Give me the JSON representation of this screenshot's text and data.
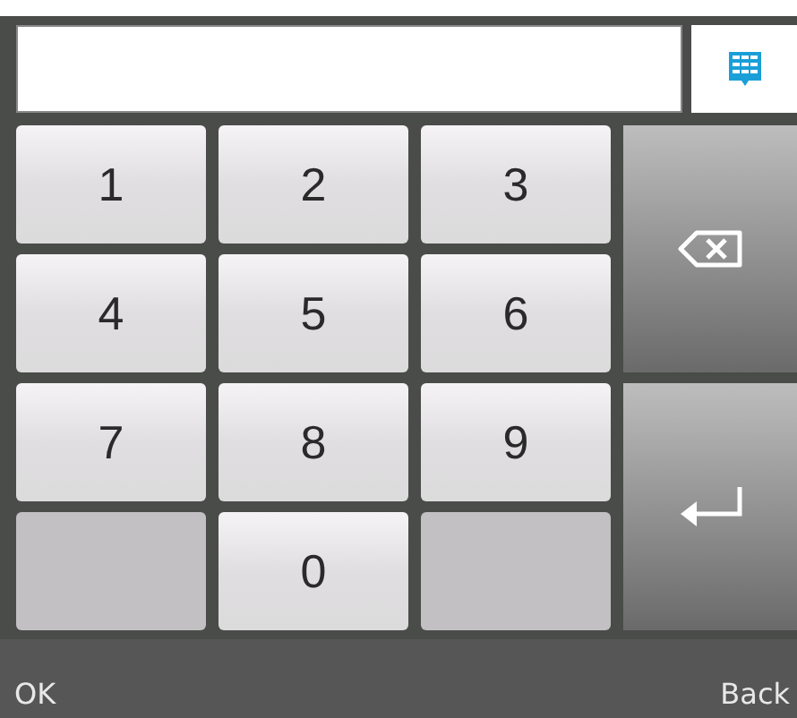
{
  "keys": [
    {
      "kind": "digit",
      "label": "1"
    },
    {
      "kind": "digit",
      "label": "2"
    },
    {
      "kind": "digit",
      "label": "3"
    },
    {
      "kind": "backspace"
    },
    {
      "kind": "digit",
      "label": "4"
    },
    {
      "kind": "digit",
      "label": "5"
    },
    {
      "kind": "digit",
      "label": "6"
    },
    {
      "kind": "digit",
      "label": "7"
    },
    {
      "kind": "digit",
      "label": "8"
    },
    {
      "kind": "digit",
      "label": "9"
    },
    {
      "kind": "enter"
    },
    {
      "kind": "blank"
    },
    {
      "kind": "digit",
      "label": "0"
    },
    {
      "kind": "blank"
    }
  ],
  "footer": {
    "left": "OK",
    "right": "Back"
  }
}
